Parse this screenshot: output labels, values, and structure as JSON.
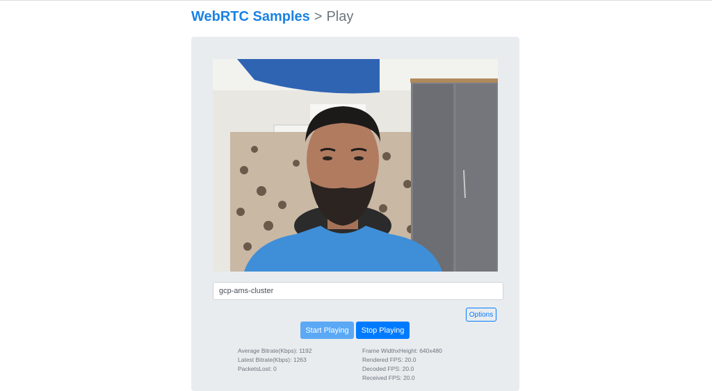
{
  "header": {
    "link_text": "WebRTC Samples",
    "separator": ">",
    "page_title": "Play"
  },
  "video": {
    "content": "remote-video-stream"
  },
  "stream": {
    "name_value": "gcp-ams-cluster"
  },
  "controls": {
    "options_label": "Options",
    "start_label": "Start Playing",
    "stop_label": "Stop Playing"
  },
  "stats": {
    "average_bitrate": "Average Bitrate(Kbps): 1192",
    "latest_bitrate": "Latest Bitrate(Kbps): 1263",
    "packets_lost": "PacketsLost: 0",
    "frame_size": "Frame WidthxHeight: 640x480",
    "rendered_fps": "Rendered FPS: 20.0",
    "decoded_fps": "Decoded FPS: 20.0",
    "received_fps": "Received FPS: 20.0"
  },
  "colors": {
    "link": "#1a82e2",
    "primary": "#007bff",
    "primary_light": "#5ba8f5",
    "panel_bg": "#e9ecef"
  }
}
